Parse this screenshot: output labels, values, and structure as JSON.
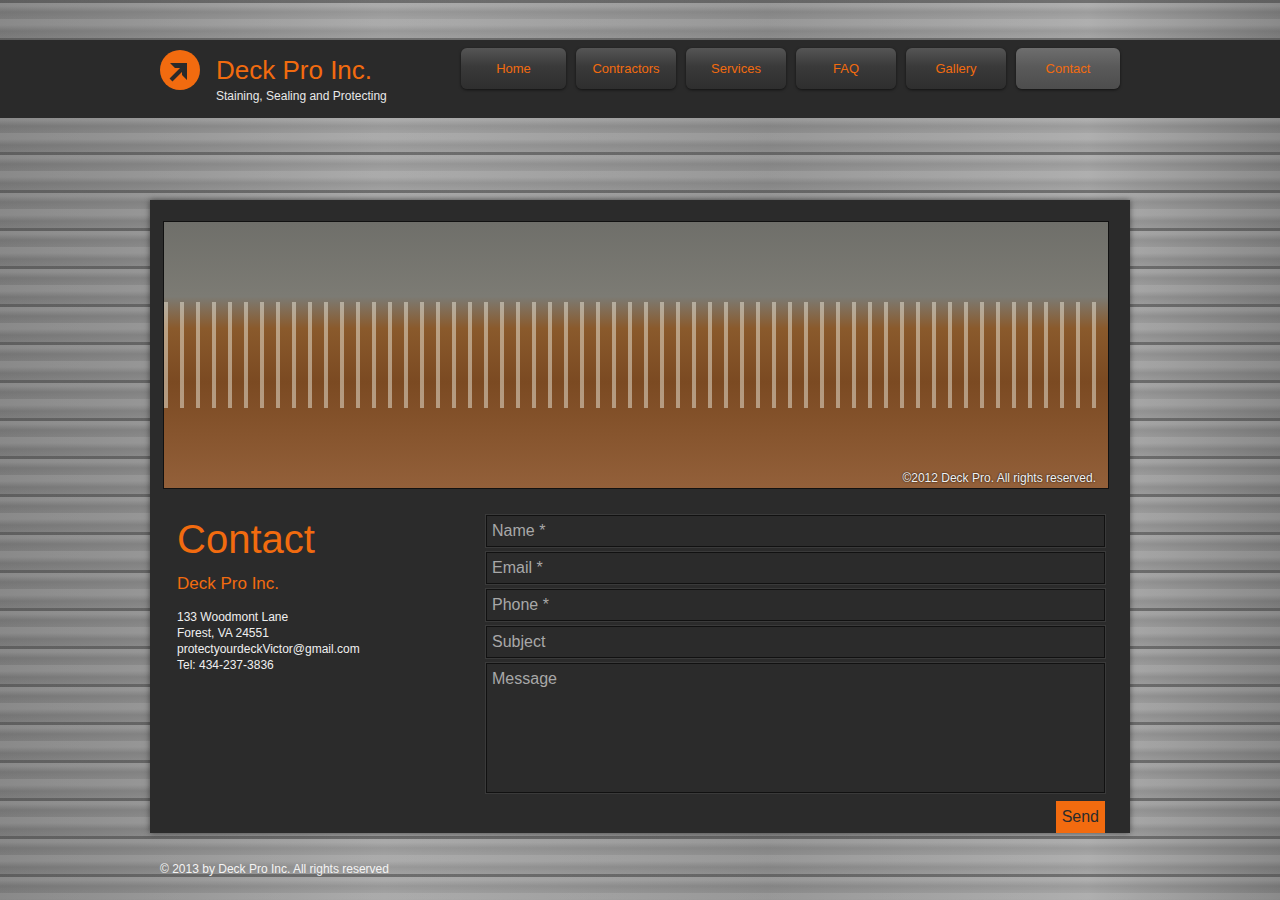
{
  "header": {
    "logo_title": "Deck Pro Inc.",
    "tagline": "Staining, Sealing and Protecting"
  },
  "nav": [
    {
      "label": "Home",
      "selected": false
    },
    {
      "label": "Contractors",
      "selected": false
    },
    {
      "label": "Services",
      "selected": false
    },
    {
      "label": "FAQ",
      "selected": false
    },
    {
      "label": "Gallery",
      "selected": false
    },
    {
      "label": "Contact",
      "selected": true
    }
  ],
  "hero": {
    "caption": "©2012 Deck Pro. All rights reserved."
  },
  "contact": {
    "heading": "Contact",
    "company": "Deck Pro Inc.",
    "lines": [
      "133 Woodmont Lane",
      "Forest, VA 24551",
      "protectyourdeckVictor@gmail.com",
      "Tel: 434-237-3836"
    ]
  },
  "form": {
    "fields": [
      {
        "placeholder": "Name *",
        "kind": "input"
      },
      {
        "placeholder": "Email *",
        "kind": "input"
      },
      {
        "placeholder": "Phone *",
        "kind": "input"
      },
      {
        "placeholder": "Subject",
        "kind": "input"
      },
      {
        "placeholder": "Message",
        "kind": "textarea"
      }
    ],
    "button": "Send"
  },
  "footer": "© 2013 by Deck Pro Inc. All rights reserved"
}
